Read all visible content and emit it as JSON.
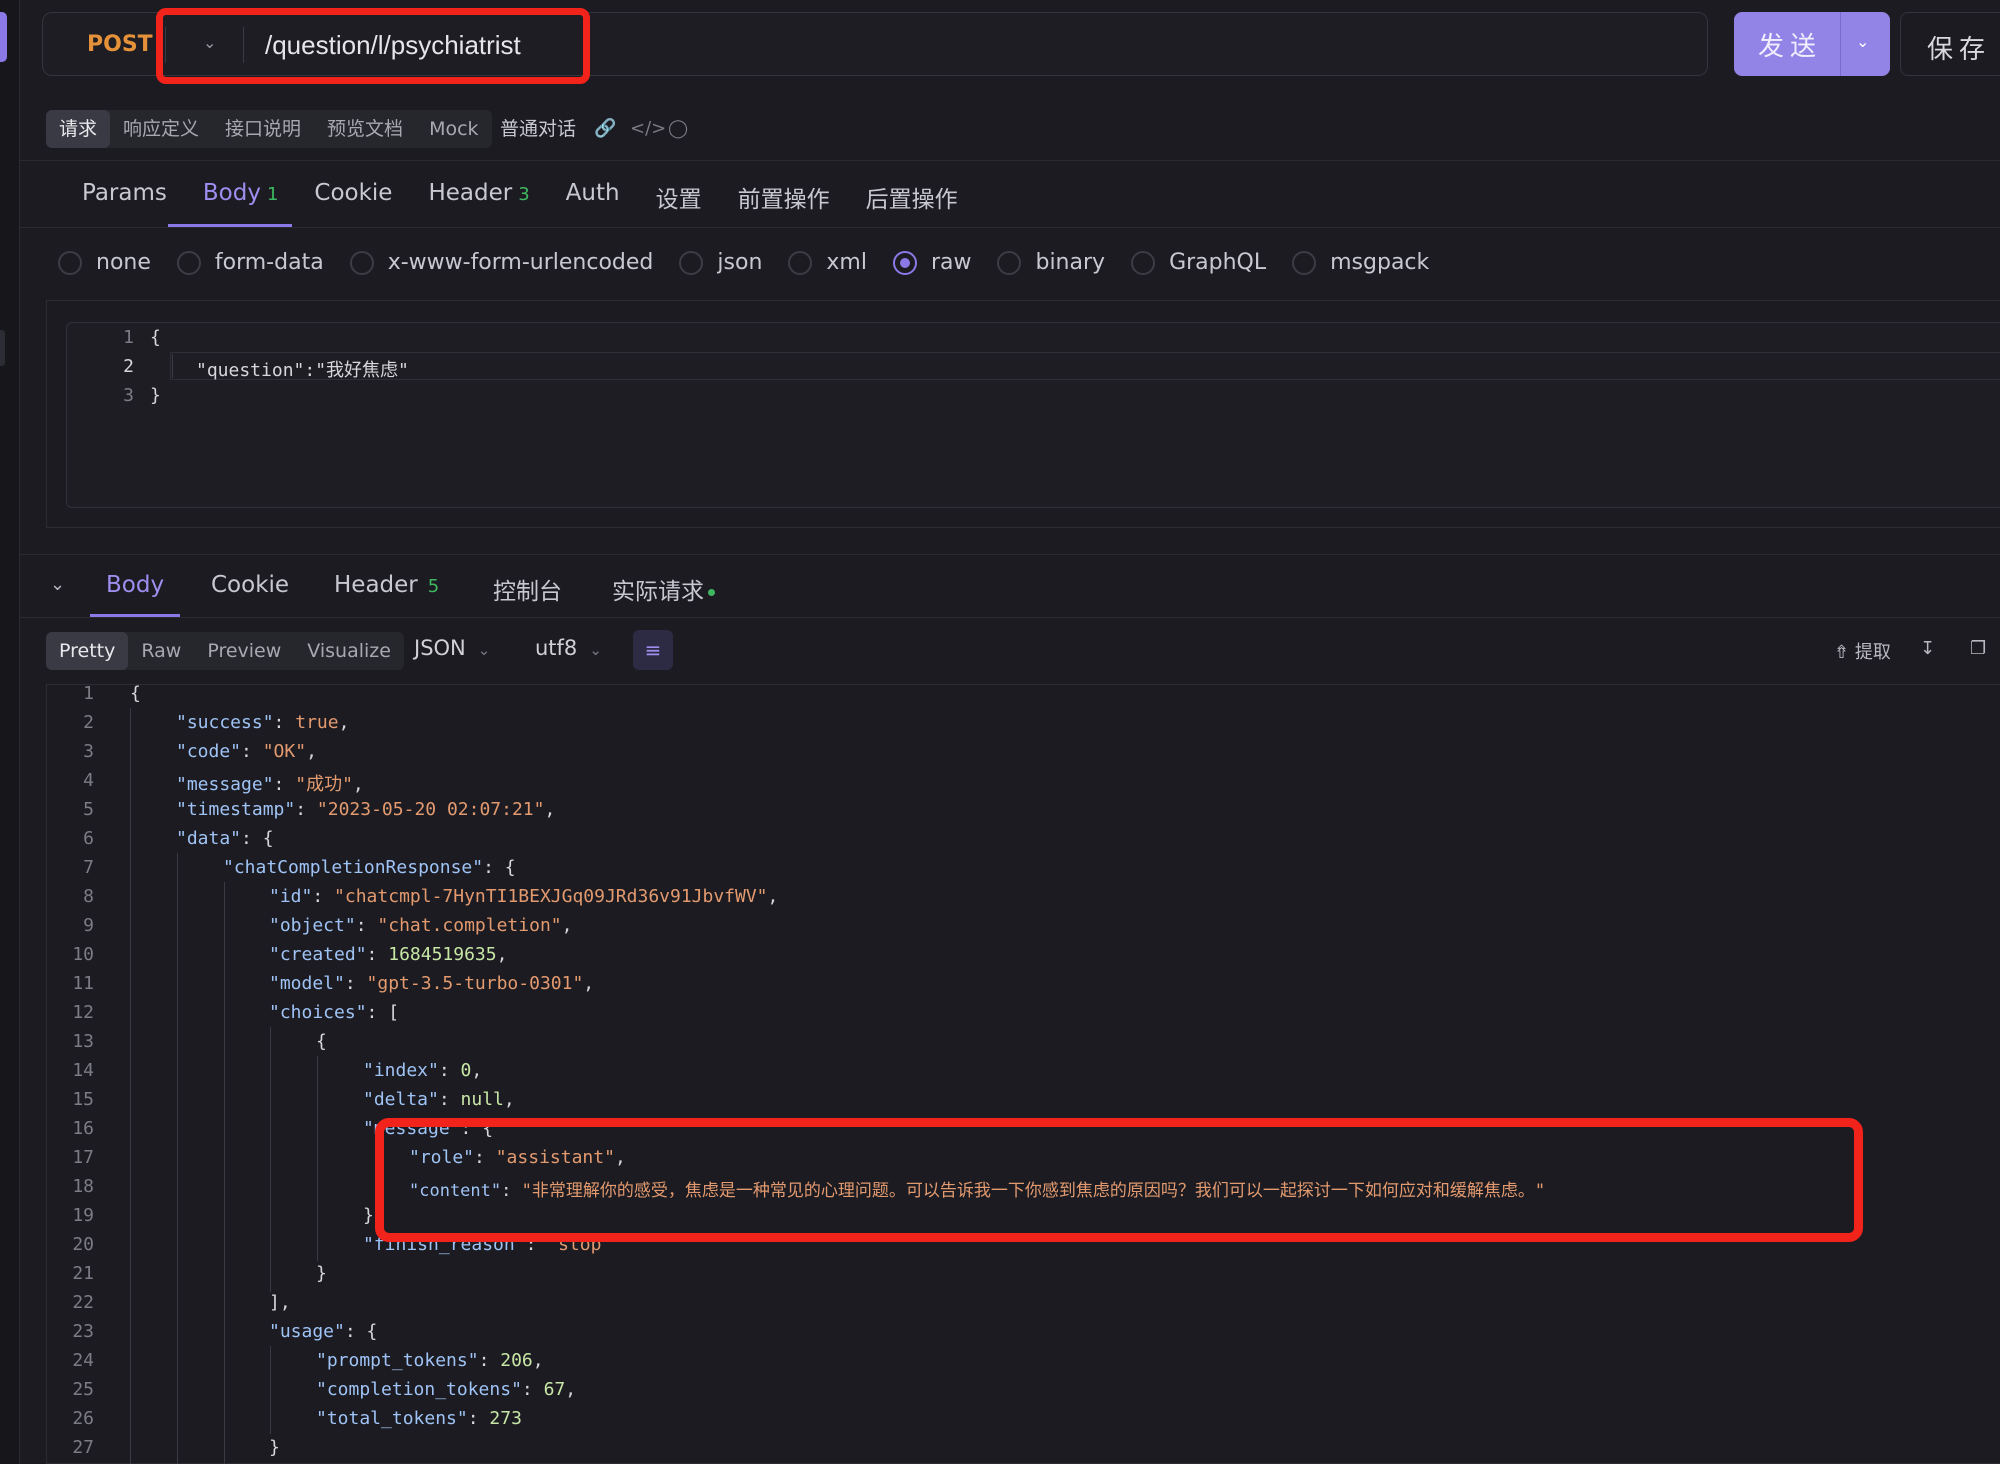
{
  "request": {
    "method": "POST",
    "url": "/question/l/psychiatrist",
    "send_label": "发送",
    "save_label": "保存"
  },
  "mode_tabs": [
    "请求",
    "响应定义",
    "接口说明",
    "预览文档",
    "Mock"
  ],
  "mode_extra": "普通对话",
  "req_tabs": [
    {
      "label": "Params",
      "badge": ""
    },
    {
      "label": "Body",
      "badge": "1"
    },
    {
      "label": "Cookie",
      "badge": ""
    },
    {
      "label": "Header",
      "badge": "3"
    },
    {
      "label": "Auth",
      "badge": ""
    },
    {
      "label": "设置",
      "badge": ""
    },
    {
      "label": "前置操作",
      "badge": ""
    },
    {
      "label": "后置操作",
      "badge": ""
    }
  ],
  "body_types": [
    "none",
    "form-data",
    "x-www-form-urlencoded",
    "json",
    "xml",
    "raw",
    "binary",
    "GraphQL",
    "msgpack"
  ],
  "body_type_selected": "raw",
  "request_body": {
    "lines": [
      "{",
      "\"question\":\"我好焦虑\"",
      "}"
    ]
  },
  "resp_tabs": [
    {
      "label": "Body",
      "badge": ""
    },
    {
      "label": "Cookie",
      "badge": ""
    },
    {
      "label": "Header",
      "badge": "5"
    },
    {
      "label": "控制台",
      "badge": ""
    },
    {
      "label": "实际请求",
      "badge": ""
    }
  ],
  "format_tabs": [
    "Pretty",
    "Raw",
    "Preview",
    "Visualize"
  ],
  "format": "JSON",
  "encoding": "utf8",
  "extract_label": "提取",
  "response_json": {
    "success": "true",
    "code": "\"OK\"",
    "message": "\"成功\"",
    "timestamp": "\"2023-05-20 02:07:21\"",
    "id": "\"chatcmpl-7HynTI1BEXJGq09JRd36v91JbvfWV\"",
    "object": "\"chat.completion\"",
    "created": "1684519635",
    "model": "\"gpt-3.5-turbo-0301\"",
    "index": "0",
    "delta": "null",
    "role": "\"assistant\"",
    "content": "\"非常理解你的感受，焦虑是一种常见的心理问题。可以告诉我一下你感到焦虑的原因吗？我们可以一起探讨一下如何应对和缓解焦虑。\"",
    "finish_reason": "\"stop\"",
    "prompt_tokens": "206",
    "completion_tokens": "67",
    "total_tokens": "273"
  }
}
